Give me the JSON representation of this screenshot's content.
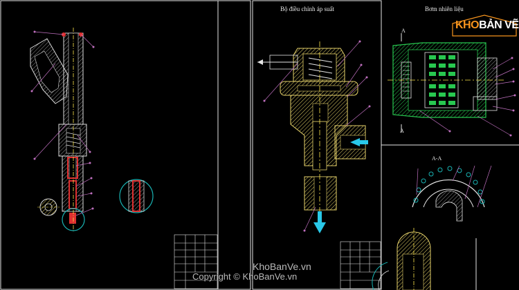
{
  "drawing": {
    "regulator_title": "Bộ điều chỉnh áp suất",
    "pump_title": "Bơm nhiên liệu",
    "section_label": "A-A",
    "section_marker_top": "A",
    "section_marker_bottom": "A"
  },
  "logo": {
    "part1": "KHO",
    "part2": "BẢN VẼ"
  },
  "watermark": {
    "site": "KhoBanVe.vn",
    "copyright": "Copyright © KhoBanVe.vn"
  },
  "colors": {
    "background": "#000000",
    "frame": "#e6e6e6",
    "hatch": "#e6d26a",
    "leader": "#c070c0",
    "centerline": "#ffe84a",
    "pump_body": "#28c850",
    "callout_circle": "#19b4b4",
    "arrow": "#29c8e8",
    "red_part": "#e03030",
    "logo_orange": "#f7941d"
  }
}
